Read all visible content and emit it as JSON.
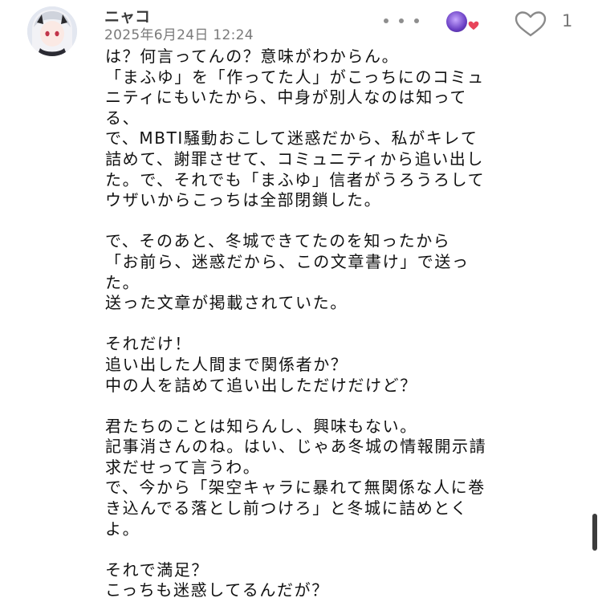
{
  "post": {
    "author_name": "ニャコ",
    "date": "2025年6月24日 12:24",
    "like_count": "1",
    "icons": {
      "more": "more-horizontal-icon",
      "like": "heart-outline-icon",
      "reactor": "reactor-avatar-heart-badge"
    },
    "colors": {
      "like_badge": "#e8445a",
      "muted_text": "#7a7a7a"
    },
    "lines": [
      "は？何言ってんの？意味がわからん。",
      "「まふゆ」を「作ってた人」がこっちにのコミュ",
      "ニティにもいたから、中身が別人なのは知って",
      "る、",
      "で、MBTI騒動おこして迷惑だから、私がキレて",
      "詰めて、謝罪させて、コミュニティから追い出し",
      "た。で、それでも「まふゆ」信者がうろうろして",
      "ウザいからこっちは全部閉鎖した。",
      "",
      "で、そのあと、冬城できてたのを知ったから",
      "「お前ら、迷惑だから、この文章書け」で送っ",
      "た。",
      "送った文章が掲載されていた。",
      "",
      "それだけ！",
      "追い出した人間まで関係者か？",
      "中の人を詰めて追い出しただけだけど？",
      "",
      "君たちのことは知らんし、興味もない。",
      "記事消さんのね。はい、じゃあ冬城の情報開示請",
      "求だせって言うわ。",
      "で、今から「架空キャラに暴れて無関係な人に巻",
      "き込んでる落とし前つけろ」と冬城に詰めとく",
      "よ。",
      "",
      "それで満足？",
      "こっちも迷惑してるんだが？"
    ]
  }
}
